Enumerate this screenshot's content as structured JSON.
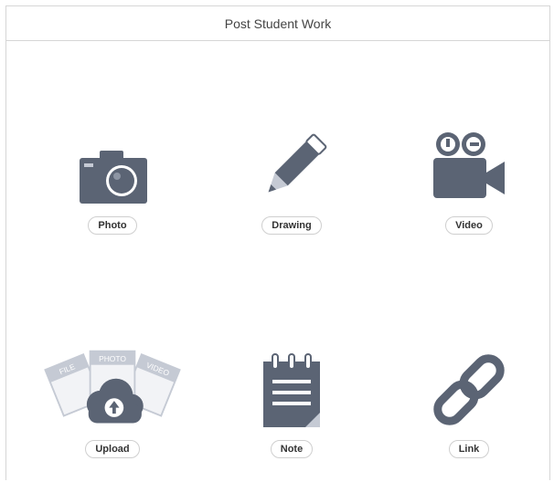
{
  "header": {
    "title": "Post Student Work"
  },
  "options": [
    {
      "label": "Photo",
      "icon": "camera-icon"
    },
    {
      "label": "Drawing",
      "icon": "pencil-icon"
    },
    {
      "label": "Video",
      "icon": "video-camera-icon"
    },
    {
      "label": "Upload",
      "icon": "upload-cloud-icon"
    },
    {
      "label": "Note",
      "icon": "notepad-icon"
    },
    {
      "label": "Link",
      "icon": "chain-link-icon"
    }
  ],
  "upload_art": {
    "file_label": "FILE",
    "photo_label": "PHOTO",
    "video_label": "VIDEO"
  },
  "colors": {
    "icon": "#5b6474",
    "icon_light": "#c5cad4",
    "border": "#d6d6d6"
  }
}
